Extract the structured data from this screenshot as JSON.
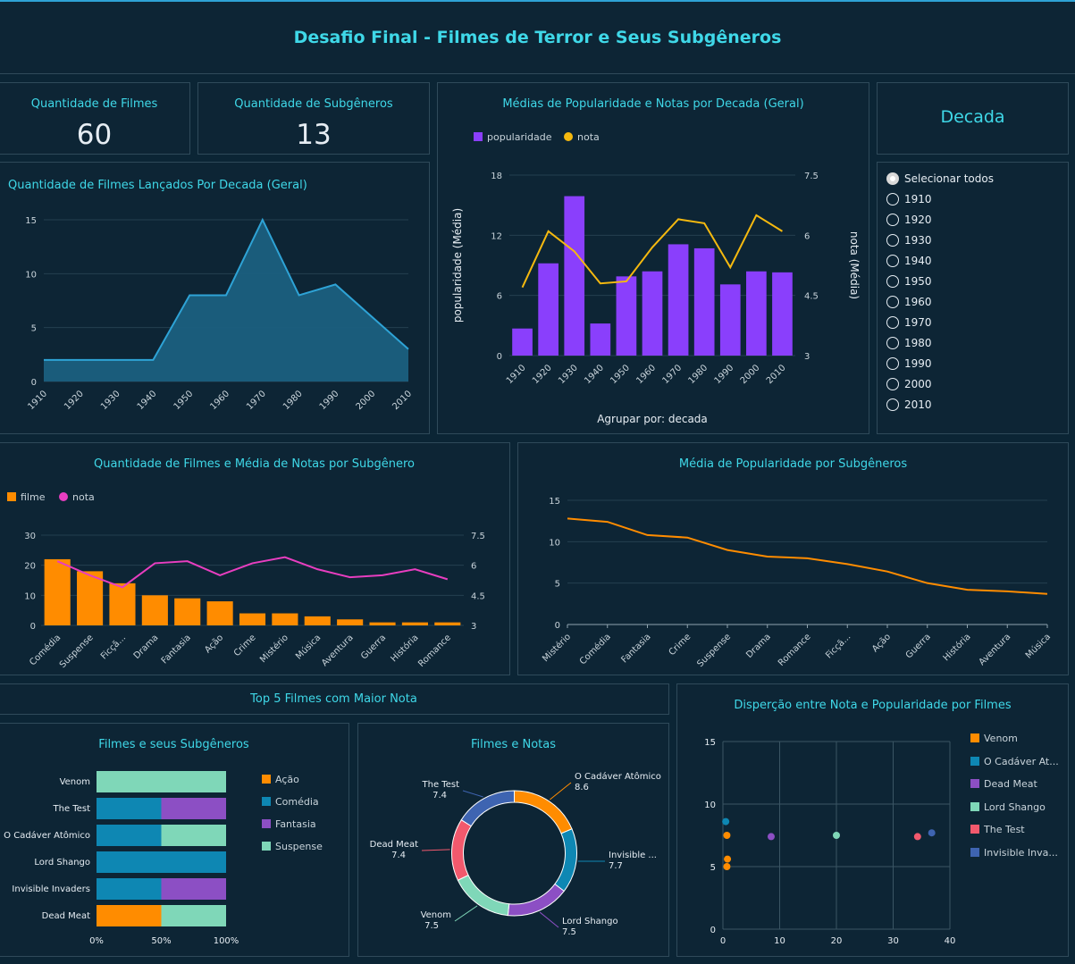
{
  "header": {
    "title": "Desafio Final - Filmes de Terror e Seus Subgêneros"
  },
  "kpis": {
    "films_label": "Quantidade de Filmes",
    "films_value": "60",
    "subgenres_label": "Quantidade de Subgêneros",
    "subgenres_value": "13"
  },
  "filter": {
    "title": "Decada",
    "select_all": "Selecionar todos",
    "options": [
      "1910",
      "1920",
      "1930",
      "1940",
      "1950",
      "1960",
      "1970",
      "1980",
      "1990",
      "2000",
      "2010"
    ]
  },
  "sections": {
    "top5_title": "Top 5 Filmes com Maior Nota",
    "donut_group_label": "Agrupar por: decada"
  },
  "colors": {
    "accent": "#3fd8e8",
    "purple": "#8a3ffc",
    "yellow": "#f5b90f",
    "orange": "#ff8c00",
    "pink": "#e83ec0",
    "area": "#1b5f80",
    "area_line": "#2ea3d6",
    "teal": "#0e87b3",
    "violet": "#8c4fc4",
    "mint": "#7fd7b8",
    "red": "#f2596d",
    "blue": "#3e64b1"
  },
  "chart_data": [
    {
      "id": "releases",
      "type": "area",
      "title": "Quantidade de Filmes Lançados Por Decada (Geral)",
      "x": [
        "1910",
        "1920",
        "1930",
        "1940",
        "1950",
        "1960",
        "1970",
        "1980",
        "1990",
        "2000",
        "2010"
      ],
      "values": [
        2,
        2,
        2,
        2,
        8,
        8,
        15,
        8,
        9,
        6,
        3
      ],
      "ylim": [
        0,
        17
      ],
      "yticks": [
        0,
        5,
        10,
        15
      ],
      "grid": true
    },
    {
      "id": "decade_combo",
      "type": "bar",
      "title": "Médias de Popularidade e Notas por Decada (Geral)",
      "categories": [
        "1910",
        "1920",
        "1930",
        "1940",
        "1950",
        "1960",
        "1970",
        "1980",
        "1990",
        "2000",
        "2010"
      ],
      "series": [
        {
          "name": "popularidade",
          "kind": "bar",
          "axis": "left",
          "values": [
            2.7,
            9.2,
            15.9,
            3.2,
            7.9,
            8.4,
            11.1,
            10.7,
            7.1,
            8.4,
            8.3
          ]
        },
        {
          "name": "nota",
          "kind": "line",
          "axis": "right",
          "values": [
            4.7,
            6.1,
            5.6,
            4.8,
            4.85,
            5.7,
            6.4,
            6.3,
            5.2,
            6.5,
            6.1
          ]
        }
      ],
      "ylabel": "popularidade (Média)",
      "y2label": "nota (Média)",
      "xlabel": "Agrupar por: decada",
      "ylim": [
        0,
        18
      ],
      "yticks": [
        0,
        6,
        12,
        18
      ],
      "y2lim": [
        3,
        7.5
      ],
      "y2ticks": [
        "3",
        "4.5",
        "6",
        "7.5"
      ],
      "legend": "top-left"
    },
    {
      "id": "subgenre_combo",
      "type": "bar",
      "title": "Quantidade de Filmes e Média de Notas por Subgênero",
      "categories": [
        "Comédia",
        "Suspense",
        "Ficçã...",
        "Drama",
        "Fantasia",
        "Ação",
        "Crime",
        "Mistério",
        "Música",
        "Aventura",
        "Guerra",
        "História",
        "Romance"
      ],
      "series": [
        {
          "name": "filme",
          "kind": "bar",
          "axis": "left",
          "values": [
            22,
            18,
            14,
            10,
            9,
            8,
            4,
            4,
            3,
            2,
            1,
            1,
            1
          ]
        },
        {
          "name": "nota",
          "kind": "line",
          "axis": "right",
          "values": [
            6.2,
            5.5,
            4.9,
            6.1,
            6.2,
            5.5,
            6.1,
            6.4,
            5.8,
            5.4,
            5.5,
            5.8,
            5.3
          ]
        }
      ],
      "ylim": [
        0,
        30
      ],
      "yticks": [
        0,
        10,
        20,
        30
      ],
      "y2lim": [
        3,
        7.5
      ],
      "y2ticks": [
        "3",
        "4.5",
        "6",
        "7.5"
      ],
      "legend": "top-left"
    },
    {
      "id": "popularity_line",
      "type": "line",
      "title": "Média de Popularidade por Subgêneros",
      "categories": [
        "Mistério",
        "Comédia",
        "Fantasia",
        "Crime",
        "Suspense",
        "Drama",
        "Romance",
        "Ficçã...",
        "Ação",
        "Guerra",
        "História",
        "Aventura",
        "Música"
      ],
      "values": [
        12.8,
        12.4,
        10.8,
        10.5,
        9.0,
        8.2,
        8.0,
        7.3,
        6.4,
        5.0,
        4.2,
        4.0,
        3.7
      ],
      "ylim": [
        0,
        15
      ],
      "yticks": [
        0,
        5,
        10,
        15
      ],
      "grid": true
    },
    {
      "id": "film_subgenres",
      "type": "bar",
      "stacked": "percent",
      "title": "Filmes e seus Subgêneros",
      "categories": [
        "Venom",
        "The Test",
        "O Cadáver Atômico",
        "Lord Shango",
        "Invisible Invaders",
        "Dead Meat"
      ],
      "series": [
        {
          "name": "Ação",
          "values": [
            0,
            0,
            0,
            0,
            0,
            50
          ]
        },
        {
          "name": "Comédia",
          "values": [
            0,
            50,
            50,
            100,
            50,
            0
          ]
        },
        {
          "name": "Fantasia",
          "values": [
            0,
            50,
            0,
            0,
            50,
            0
          ]
        },
        {
          "name": "Suspense",
          "values": [
            100,
            0,
            50,
            0,
            0,
            50
          ]
        }
      ],
      "xticks": [
        "0%",
        "50%",
        "100%"
      ],
      "legend": "right"
    },
    {
      "id": "film_scores",
      "type": "pie",
      "donut": true,
      "title": "Filmes e Notas",
      "slices": [
        {
          "label": "O Cadáver Atômico",
          "value": 8.6
        },
        {
          "label": "Invisible ...",
          "value": 7.7
        },
        {
          "label": "Lord Shango",
          "value": 7.5
        },
        {
          "label": "Venom",
          "value": 7.5
        },
        {
          "label": "Dead Meat",
          "value": 7.4
        },
        {
          "label": "The Test",
          "value": 7.4
        }
      ]
    },
    {
      "id": "scatter",
      "type": "scatter",
      "title": "Disperção entre Nota e Popularidade por Filmes",
      "series": [
        {
          "name": "Venom",
          "points": [
            [
              0.7,
              7.5
            ],
            [
              0.8,
              5.6
            ],
            [
              0.7,
              5.0
            ]
          ]
        },
        {
          "name": "O Cadáver At...",
          "points": [
            [
              0.5,
              8.6
            ]
          ]
        },
        {
          "name": "Dead Meat",
          "points": [
            [
              8.5,
              7.4
            ]
          ]
        },
        {
          "name": "Lord Shango",
          "points": [
            [
              20,
              7.5
            ]
          ]
        },
        {
          "name": "The Test",
          "points": [
            [
              34.3,
              7.4
            ]
          ]
        },
        {
          "name": "Invisible Inva...",
          "points": [
            [
              36.8,
              7.7
            ]
          ]
        }
      ],
      "xlim": [
        0,
        40
      ],
      "xticks": [
        0,
        10,
        20,
        30,
        40
      ],
      "ylim": [
        0,
        15
      ],
      "yticks": [
        0,
        5,
        10,
        15
      ],
      "legend": "right"
    }
  ]
}
